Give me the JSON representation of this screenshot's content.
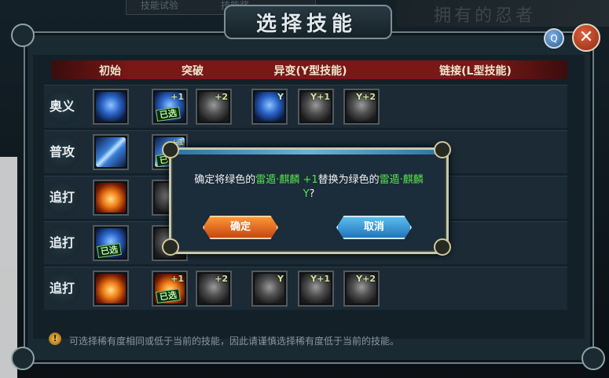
{
  "background": {
    "tabs": [
      "技能试验",
      "技能奖"
    ],
    "right_title": "拥有的忍者"
  },
  "panel": {
    "title": "选择技能",
    "help_label": "Q",
    "close_label": "✕",
    "columns": [
      "初始",
      "突破",
      "异变(Y型技能)",
      "链接(L型技能)"
    ]
  },
  "rows": [
    {
      "label": "奥义",
      "slots": [
        {
          "col": "initial",
          "icon": "blue-beast-icon",
          "badge": "",
          "chosen": false
        },
        {
          "col": "breakthrough",
          "icon": "blue-beast-icon",
          "badge": "+1",
          "chosen": true
        },
        {
          "col": "breakthrough",
          "icon": "gray-beast-icon",
          "badge": "+2",
          "chosen": false
        },
        {
          "col": "mutation",
          "icon": "blue-beast-icon",
          "badge": "Y",
          "chosen": false
        },
        {
          "col": "mutation",
          "icon": "gray-beast-icon",
          "badge": "Y+1",
          "chosen": false
        },
        {
          "col": "mutation",
          "icon": "gray-beast-icon",
          "badge": "Y+2",
          "chosen": false
        }
      ]
    },
    {
      "label": "普攻",
      "slots": [
        {
          "col": "initial",
          "icon": "lightning-icon",
          "badge": "",
          "chosen": false
        },
        {
          "col": "breakthrough",
          "icon": "lightning-icon",
          "badge": "+1",
          "chosen": true
        }
      ]
    },
    {
      "label": "追打",
      "slots": [
        {
          "col": "initial",
          "icon": "fireball-icon",
          "badge": "",
          "chosen": false
        },
        {
          "col": "breakthrough",
          "icon": "gray-icon",
          "badge": "",
          "chosen": false
        }
      ]
    },
    {
      "label": "追打",
      "slots": [
        {
          "col": "initial",
          "icon": "blue-beast-icon",
          "badge": "",
          "chosen": true
        },
        {
          "col": "breakthrough",
          "icon": "gray-icon",
          "badge": "",
          "chosen": false
        }
      ]
    },
    {
      "label": "追打",
      "slots": [
        {
          "col": "initial",
          "icon": "fireball-icon",
          "badge": "",
          "chosen": false
        },
        {
          "col": "breakthrough",
          "icon": "fireball-icon",
          "badge": "+1",
          "chosen": true
        },
        {
          "col": "breakthrough",
          "icon": "gray-fire-icon",
          "badge": "+2",
          "chosen": false
        },
        {
          "col": "mutation",
          "icon": "gray-fire-icon",
          "badge": "Y",
          "chosen": false
        },
        {
          "col": "mutation",
          "icon": "gray-fire-icon",
          "badge": "Y+1",
          "chosen": false
        },
        {
          "col": "mutation",
          "icon": "gray-fire-icon",
          "badge": "Y+2",
          "chosen": false
        }
      ]
    }
  ],
  "chosen_label": "已选",
  "tip": "可选择稀有度相同或低于当前的技能，因此请谨慎选择稀有度低于当前的技能。",
  "dialog": {
    "msg_part1": "确定将绿色的",
    "skill_old": "雷遁·麒麟 +1",
    "msg_part2": "替换为绿色的",
    "skill_new": "雷遁·麒麟",
    "skill_new_suffix": "Y",
    "msg_end": "?",
    "confirm_label": "确定",
    "cancel_label": "取消"
  },
  "colors": {
    "highlight_green": "#58e24a",
    "confirm_orange": "#e0631f",
    "cancel_blue": "#2b8ad0",
    "header_red": "#7a1717"
  }
}
